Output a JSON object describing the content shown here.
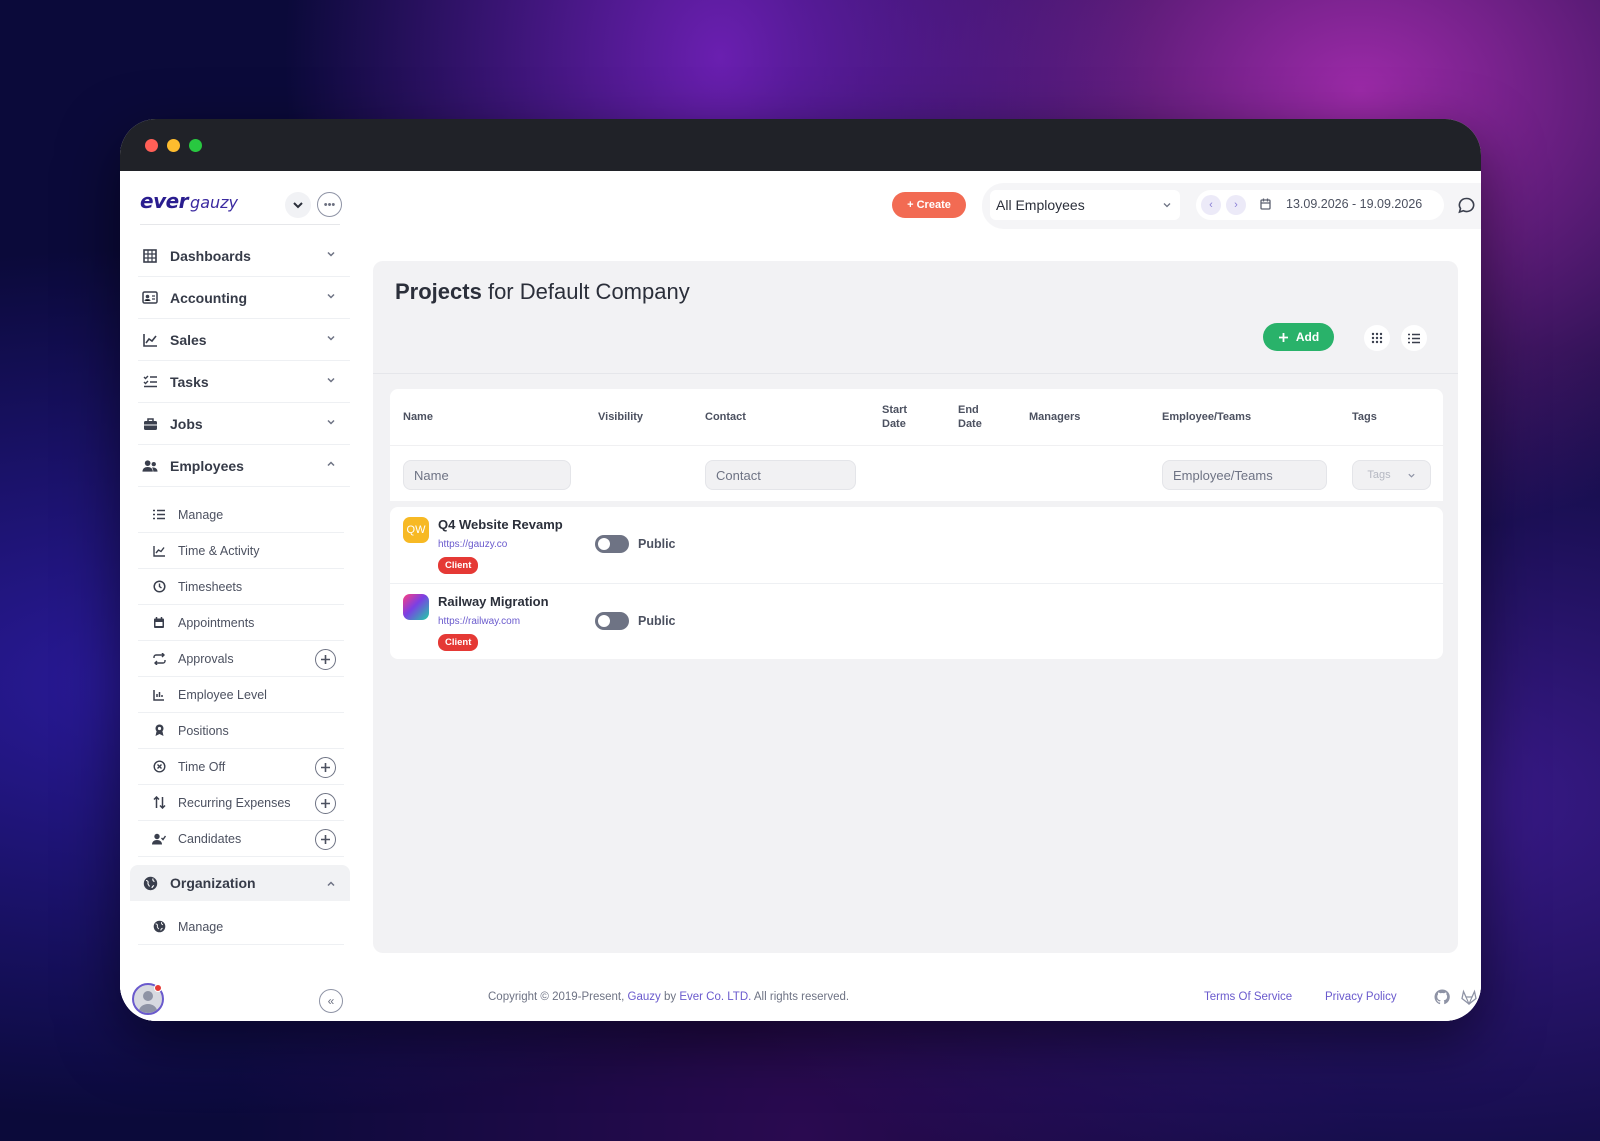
{
  "logo": {
    "brand_bold": "ever",
    "brand_light": "gauzy"
  },
  "sidebar": {
    "items": [
      {
        "label": "Dashboards",
        "icon": "grid-icon"
      },
      {
        "label": "Accounting",
        "icon": "id-card-icon"
      },
      {
        "label": "Sales",
        "icon": "chart-line-icon"
      },
      {
        "label": "Tasks",
        "icon": "task-list-icon"
      },
      {
        "label": "Jobs",
        "icon": "briefcase-icon"
      },
      {
        "label": "Employees",
        "icon": "users-icon"
      }
    ],
    "employees_sub": [
      {
        "label": "Manage",
        "icon": "list-icon"
      },
      {
        "label": "Time & Activity",
        "icon": "chart-line-icon"
      },
      {
        "label": "Timesheets",
        "icon": "clock-icon"
      },
      {
        "label": "Appointments",
        "icon": "calendar-icon"
      },
      {
        "label": "Approvals",
        "icon": "repeat-icon"
      },
      {
        "label": "Employee Level",
        "icon": "bar-chart-icon"
      },
      {
        "label": "Positions",
        "icon": "award-icon"
      },
      {
        "label": "Time Off",
        "icon": "circle-x-icon"
      },
      {
        "label": "Recurring Expenses",
        "icon": "sort-arrows-icon"
      },
      {
        "label": "Candidates",
        "icon": "user-check-icon"
      }
    ],
    "organization": {
      "label": "Organization",
      "icon": "globe-icon"
    },
    "org_sub": [
      {
        "label": "Manage",
        "icon": "globe-icon"
      }
    ]
  },
  "header": {
    "create_label": "+ Create",
    "employee_select": "All Employees",
    "date_range": "13.09.2026 - 19.09.2026"
  },
  "page": {
    "title_bold": "Projects",
    "title_rest": "for Default Company",
    "add_label": "Add"
  },
  "table": {
    "headers": {
      "name": "Name",
      "visibility": "Visibility",
      "contact": "Contact",
      "start_line1": "Start",
      "start_line2": "Date",
      "end_line1": "End",
      "end_line2": "Date",
      "managers": "Managers",
      "employee_teams": "Employee/Teams",
      "tags": "Tags"
    },
    "filters": {
      "name": "Name",
      "contact": "Contact",
      "employee_teams": "Employee/Teams",
      "tags": "Tags"
    },
    "rows": [
      {
        "logo_text": "QW",
        "logo_color": "#f7b924",
        "name": "Q4 Website Revamp",
        "url": "https://gauzy.co",
        "badge": "Client",
        "visibility": "Public"
      },
      {
        "logo_text": "",
        "logo_color": "#7b3fe4",
        "name": "Railway Migration",
        "url": "https://railway.com",
        "badge": "Client",
        "visibility": "Public"
      }
    ]
  },
  "footer": {
    "copyright_pre": "Copyright © 2019-Present, ",
    "gauzy": "Gauzy",
    "by": " by ",
    "ever": "Ever Co. LTD.",
    "rights": " All rights reserved.",
    "terms": "Terms Of Service",
    "privacy": "Privacy Policy"
  },
  "colors": {
    "accent": "#6a5acd",
    "create": "#f26b53",
    "add": "#29b26a",
    "badge": "#e53935"
  }
}
